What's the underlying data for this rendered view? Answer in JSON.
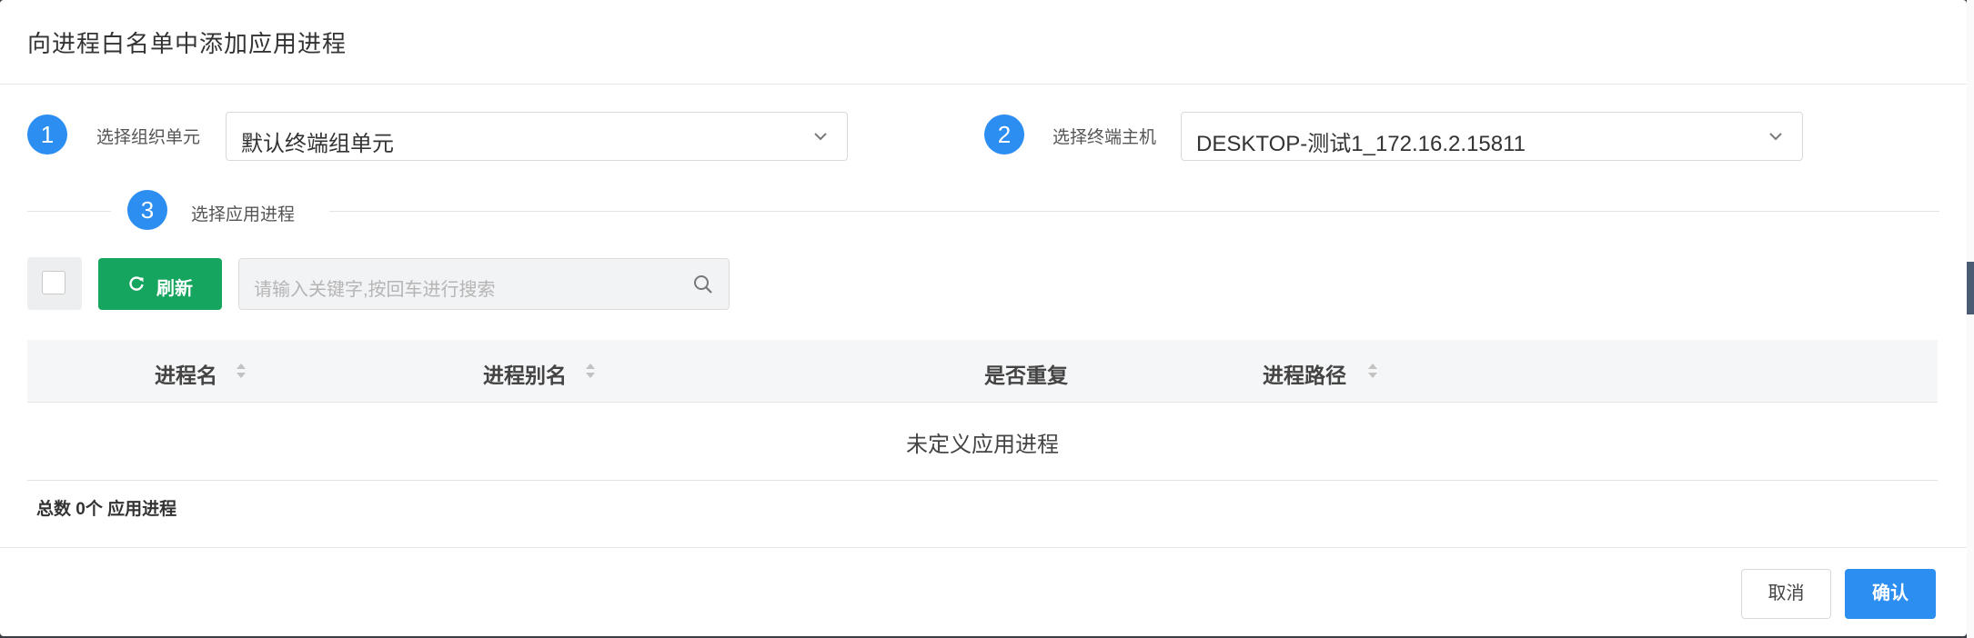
{
  "dialog": {
    "title": "向进程白名单中添加应用进程"
  },
  "step1": {
    "number": "1",
    "label": "选择组织单元",
    "value": "默认终端组单元"
  },
  "step2": {
    "number": "2",
    "label": "选择终端主机",
    "value": "DESKTOP-测试1_172.16.2.15811"
  },
  "step3": {
    "number": "3",
    "label": "选择应用进程"
  },
  "toolbar": {
    "refresh_label": "刷新",
    "search_placeholder": "请输入关键字,按回车进行搜索"
  },
  "table": {
    "columns": [
      "进程名",
      "进程别名",
      "是否重复",
      "进程路径"
    ],
    "empty_text": "未定义应用进程"
  },
  "summary": "总数 0个 应用进程",
  "footer": {
    "cancel_label": "取消",
    "confirm_label": "确认"
  },
  "colors": {
    "primary": "#2b8ef0",
    "refresh": "#16a55e"
  }
}
